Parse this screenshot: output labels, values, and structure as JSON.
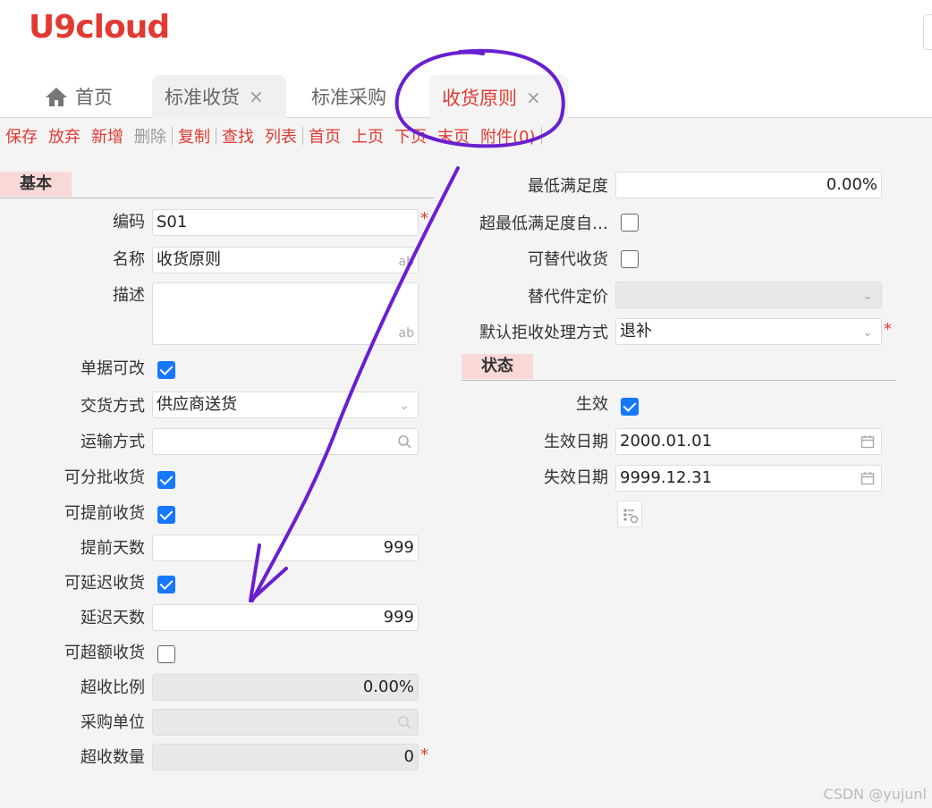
{
  "app": {
    "logo": "U9cloud"
  },
  "tabs": [
    {
      "label": "首页",
      "icon": "home-icon"
    },
    {
      "label": "标准收货",
      "close": "×"
    },
    {
      "label": "标准采购"
    },
    {
      "label": "收货原则",
      "close": "×",
      "active": true
    }
  ],
  "toolbar": {
    "items": [
      "保存",
      "放弃",
      "新增",
      "删除",
      "复制",
      "查找",
      "列表",
      "首页",
      "上页",
      "下页",
      "末页",
      "附件(0)"
    ]
  },
  "left": {
    "section": "基本",
    "fields": {
      "code_label": "编码",
      "code_value": "S01",
      "name_label": "名称",
      "name_value": "收货原则",
      "desc_label": "描述",
      "doc_editable_label": "单据可改",
      "delivery_label": "交货方式",
      "delivery_value": "供应商送货",
      "transport_label": "运输方式",
      "partial_label": "可分批收货",
      "early_label": "可提前收货",
      "early_days_label": "提前天数",
      "early_days_value": "999",
      "late_label": "可延迟收货",
      "late_days_label": "延迟天数",
      "late_days_value": "999",
      "over_label": "可超额收货",
      "over_ratio_label": "超收比例",
      "over_ratio_value": "0.00%",
      "unit_label": "采购单位",
      "over_qty_label": "超收数量",
      "over_qty_value": "0"
    },
    "ab_suffix": "ab",
    "required_mark": "*"
  },
  "right": {
    "min_sat_label": "最低满足度",
    "min_sat_value": "0.00%",
    "over_min_label": "超最低满足度自…",
    "substitute_label": "可替代收货",
    "sub_price_label": "替代件定价",
    "reject_label": "默认拒收处理方式",
    "reject_value": "退补",
    "status_section": "状态",
    "effective_label": "生效",
    "eff_date_label": "生效日期",
    "eff_date_value": "2000.01.01",
    "exp_date_label": "失效日期",
    "exp_date_value": "9999.12.31"
  },
  "watermark": "CSDN @yujunl",
  "colors": {
    "accent": "#e23a33",
    "checkbox": "#1677ff",
    "annotation": "#6a1fd0",
    "section_bg": "#f9d9d7"
  }
}
